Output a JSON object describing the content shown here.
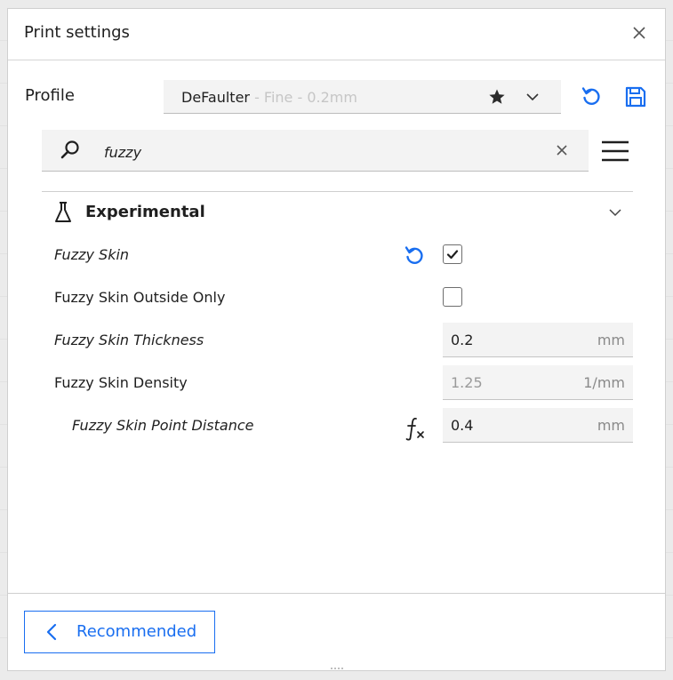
{
  "header": {
    "title": "Print settings"
  },
  "profile": {
    "label": "Profile",
    "name": "DeFaulter",
    "sub": " - Fine - 0.2mm"
  },
  "search": {
    "value": "fuzzy"
  },
  "category": {
    "title": "Experimental"
  },
  "settings": [
    {
      "label": "Fuzzy Skin",
      "type": "checkbox",
      "checked": true,
      "modified": true
    },
    {
      "label": "Fuzzy Skin Outside Only",
      "type": "checkbox",
      "checked": false
    },
    {
      "label": "Fuzzy Skin Thickness",
      "type": "number",
      "value": "0.2",
      "unit": "mm"
    },
    {
      "label": "Fuzzy Skin Density",
      "type": "number",
      "value": "1.25",
      "unit": "1/mm",
      "disabled": true
    },
    {
      "label": "Fuzzy Skin Point Distance",
      "type": "number",
      "value": "0.4",
      "unit": "mm"
    }
  ],
  "footer": {
    "recommended_label": "Recommended"
  },
  "colors": {
    "accent": "#196ef0",
    "text": "#1f1f1f",
    "muted": "#c6c6c6",
    "field_bg": "#f3f3f3"
  },
  "icons": [
    "close-icon",
    "star-icon",
    "chevron-down-icon",
    "reset-icon",
    "save-icon",
    "search-icon",
    "menu-icon",
    "flask-icon",
    "check-icon",
    "function-icon",
    "chevron-left-icon"
  ]
}
